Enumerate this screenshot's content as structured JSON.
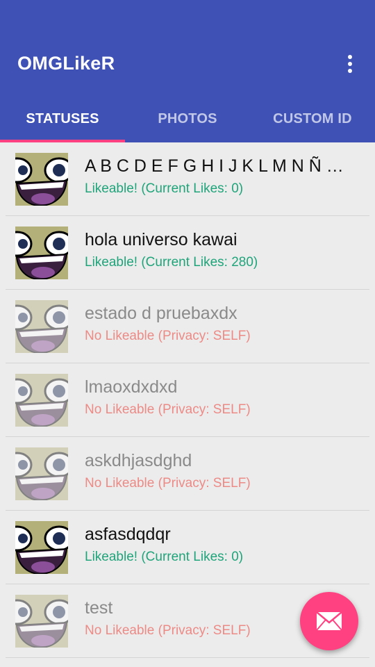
{
  "app": {
    "title": "OMGLikeR"
  },
  "tabs": [
    {
      "label": "STATUSES",
      "active": true
    },
    {
      "label": "PHOTOS",
      "active": false
    },
    {
      "label": "CUSTOM ID",
      "active": false
    }
  ],
  "statuses": [
    {
      "title": "A B C D E F G H I J K L M N Ñ O P Q R S T U V W X Y Z",
      "status": "Likeable! (Current Likes: 0)",
      "likeable": true
    },
    {
      "title": "hola universo kawai",
      "status": "Likeable! (Current Likes: 280)",
      "likeable": true
    },
    {
      "title": "estado d pruebaxdx",
      "status": "No Likeable (Privacy: SELF)",
      "likeable": false
    },
    {
      "title": "lmaoxdxdxd",
      "status": "No Likeable (Privacy: SELF)",
      "likeable": false
    },
    {
      "title": "askdhjasdghd",
      "status": "No Likeable (Privacy: SELF)",
      "likeable": false
    },
    {
      "title": "asfasdqdqr",
      "status": "Likeable! (Current Likes: 0)",
      "likeable": true
    },
    {
      "title": "test",
      "status": "No Likeable (Privacy: SELF)",
      "likeable": false
    }
  ],
  "icons": {
    "menu": "more-vert-icon",
    "fab": "mail-icon",
    "avatar": "awesome-face-icon"
  },
  "colors": {
    "primary": "#3f51b5",
    "accent": "#ff4081",
    "likeable": "#1fa47a",
    "not_likeable": "#ec8a86"
  }
}
